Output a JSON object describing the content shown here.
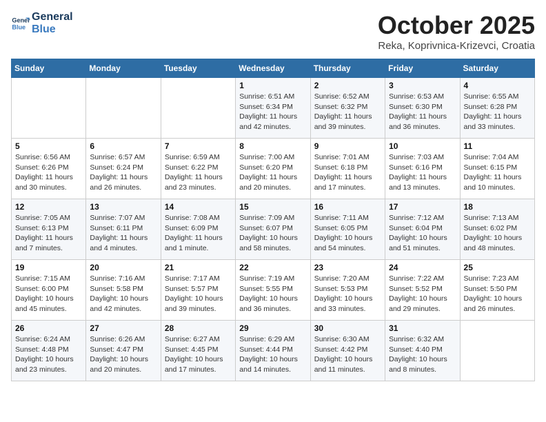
{
  "header": {
    "logo_line1": "General",
    "logo_line2": "Blue",
    "month": "October 2025",
    "location": "Reka, Koprivnica-Krizevci, Croatia"
  },
  "weekdays": [
    "Sunday",
    "Monday",
    "Tuesday",
    "Wednesday",
    "Thursday",
    "Friday",
    "Saturday"
  ],
  "weeks": [
    [
      {
        "day": "",
        "info": ""
      },
      {
        "day": "",
        "info": ""
      },
      {
        "day": "",
        "info": ""
      },
      {
        "day": "1",
        "info": "Sunrise: 6:51 AM\nSunset: 6:34 PM\nDaylight: 11 hours\nand 42 minutes."
      },
      {
        "day": "2",
        "info": "Sunrise: 6:52 AM\nSunset: 6:32 PM\nDaylight: 11 hours\nand 39 minutes."
      },
      {
        "day": "3",
        "info": "Sunrise: 6:53 AM\nSunset: 6:30 PM\nDaylight: 11 hours\nand 36 minutes."
      },
      {
        "day": "4",
        "info": "Sunrise: 6:55 AM\nSunset: 6:28 PM\nDaylight: 11 hours\nand 33 minutes."
      }
    ],
    [
      {
        "day": "5",
        "info": "Sunrise: 6:56 AM\nSunset: 6:26 PM\nDaylight: 11 hours\nand 30 minutes."
      },
      {
        "day": "6",
        "info": "Sunrise: 6:57 AM\nSunset: 6:24 PM\nDaylight: 11 hours\nand 26 minutes."
      },
      {
        "day": "7",
        "info": "Sunrise: 6:59 AM\nSunset: 6:22 PM\nDaylight: 11 hours\nand 23 minutes."
      },
      {
        "day": "8",
        "info": "Sunrise: 7:00 AM\nSunset: 6:20 PM\nDaylight: 11 hours\nand 20 minutes."
      },
      {
        "day": "9",
        "info": "Sunrise: 7:01 AM\nSunset: 6:18 PM\nDaylight: 11 hours\nand 17 minutes."
      },
      {
        "day": "10",
        "info": "Sunrise: 7:03 AM\nSunset: 6:16 PM\nDaylight: 11 hours\nand 13 minutes."
      },
      {
        "day": "11",
        "info": "Sunrise: 7:04 AM\nSunset: 6:15 PM\nDaylight: 11 hours\nand 10 minutes."
      }
    ],
    [
      {
        "day": "12",
        "info": "Sunrise: 7:05 AM\nSunset: 6:13 PM\nDaylight: 11 hours\nand 7 minutes."
      },
      {
        "day": "13",
        "info": "Sunrise: 7:07 AM\nSunset: 6:11 PM\nDaylight: 11 hours\nand 4 minutes."
      },
      {
        "day": "14",
        "info": "Sunrise: 7:08 AM\nSunset: 6:09 PM\nDaylight: 11 hours\nand 1 minute."
      },
      {
        "day": "15",
        "info": "Sunrise: 7:09 AM\nSunset: 6:07 PM\nDaylight: 10 hours\nand 58 minutes."
      },
      {
        "day": "16",
        "info": "Sunrise: 7:11 AM\nSunset: 6:05 PM\nDaylight: 10 hours\nand 54 minutes."
      },
      {
        "day": "17",
        "info": "Sunrise: 7:12 AM\nSunset: 6:04 PM\nDaylight: 10 hours\nand 51 minutes."
      },
      {
        "day": "18",
        "info": "Sunrise: 7:13 AM\nSunset: 6:02 PM\nDaylight: 10 hours\nand 48 minutes."
      }
    ],
    [
      {
        "day": "19",
        "info": "Sunrise: 7:15 AM\nSunset: 6:00 PM\nDaylight: 10 hours\nand 45 minutes."
      },
      {
        "day": "20",
        "info": "Sunrise: 7:16 AM\nSunset: 5:58 PM\nDaylight: 10 hours\nand 42 minutes."
      },
      {
        "day": "21",
        "info": "Sunrise: 7:17 AM\nSunset: 5:57 PM\nDaylight: 10 hours\nand 39 minutes."
      },
      {
        "day": "22",
        "info": "Sunrise: 7:19 AM\nSunset: 5:55 PM\nDaylight: 10 hours\nand 36 minutes."
      },
      {
        "day": "23",
        "info": "Sunrise: 7:20 AM\nSunset: 5:53 PM\nDaylight: 10 hours\nand 33 minutes."
      },
      {
        "day": "24",
        "info": "Sunrise: 7:22 AM\nSunset: 5:52 PM\nDaylight: 10 hours\nand 29 minutes."
      },
      {
        "day": "25",
        "info": "Sunrise: 7:23 AM\nSunset: 5:50 PM\nDaylight: 10 hours\nand 26 minutes."
      }
    ],
    [
      {
        "day": "26",
        "info": "Sunrise: 6:24 AM\nSunset: 4:48 PM\nDaylight: 10 hours\nand 23 minutes."
      },
      {
        "day": "27",
        "info": "Sunrise: 6:26 AM\nSunset: 4:47 PM\nDaylight: 10 hours\nand 20 minutes."
      },
      {
        "day": "28",
        "info": "Sunrise: 6:27 AM\nSunset: 4:45 PM\nDaylight: 10 hours\nand 17 minutes."
      },
      {
        "day": "29",
        "info": "Sunrise: 6:29 AM\nSunset: 4:44 PM\nDaylight: 10 hours\nand 14 minutes."
      },
      {
        "day": "30",
        "info": "Sunrise: 6:30 AM\nSunset: 4:42 PM\nDaylight: 10 hours\nand 11 minutes."
      },
      {
        "day": "31",
        "info": "Sunrise: 6:32 AM\nSunset: 4:40 PM\nDaylight: 10 hours\nand 8 minutes."
      },
      {
        "day": "",
        "info": ""
      }
    ]
  ]
}
